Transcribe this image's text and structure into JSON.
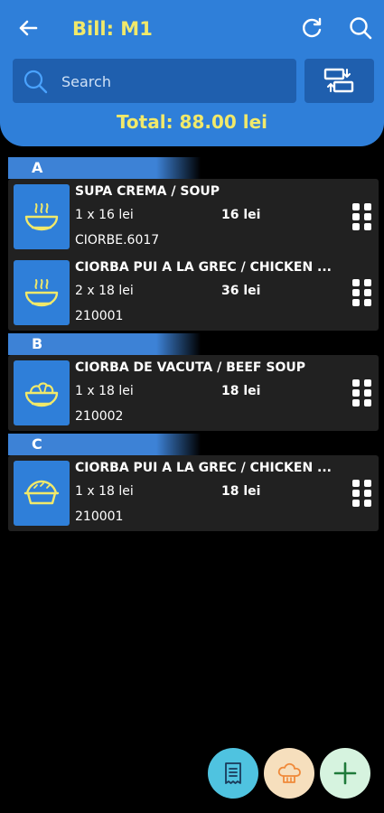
{
  "header": {
    "title": "Bill: M1",
    "search_placeholder": "Search",
    "total": "Total: 88.00 lei"
  },
  "sections": [
    {
      "label": "A",
      "items": [
        {
          "name": "SUPA CREMA  / SOUP",
          "qty": "1 x 16 lei",
          "total": "16 lei",
          "code": "CIORBE.6017",
          "icon": "soup-bowl-icon"
        },
        {
          "name": "CIORBA PUI  A LA GREC / CHICKEN ...",
          "qty": "2 x 18 lei",
          "total": "36 lei",
          "code": "210001",
          "icon": "soup-bowl-icon"
        }
      ]
    },
    {
      "label": "B",
      "items": [
        {
          "name": "CIORBA DE VACUTA / BEEF SOUP",
          "qty": "1 x 18 lei",
          "total": "18 lei",
          "code": "210002",
          "icon": "salad-bowl-icon"
        }
      ]
    },
    {
      "label": "C",
      "items": [
        {
          "name": "CIORBA PUI  A LA GREC / CHICKEN ...",
          "qty": "1 x 18 lei",
          "total": "18 lei",
          "code": "210001",
          "icon": "pie-icon"
        }
      ]
    }
  ],
  "colors": {
    "header_blue": "#2f7fd9",
    "accent_yellow": "#f1e96a",
    "card_bg": "#212121",
    "fab_receipt": "#4fc3e0",
    "fab_chef": "#f6dfbd",
    "fab_add": "#d6f3df"
  }
}
